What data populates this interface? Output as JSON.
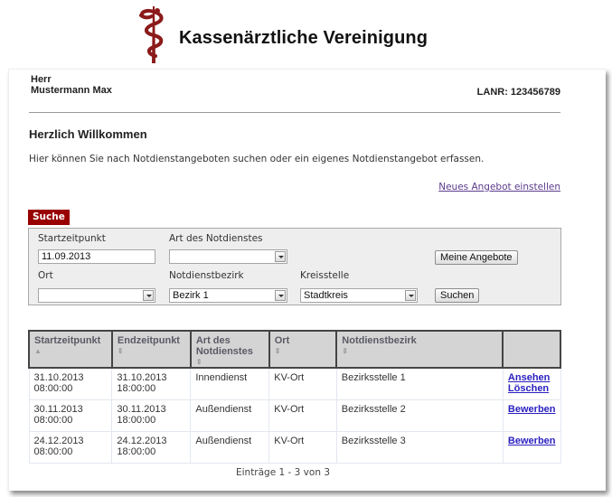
{
  "header": {
    "logo_icon": "rod-of-asclepius-icon",
    "brand_name": "Kassenärztliche Vereinigung",
    "brand_color": "#8b1a1a"
  },
  "user": {
    "salutation": "Herr",
    "name": "Mustermann Max",
    "lanr": "LANR: 123456789"
  },
  "intro": {
    "title": "Herzlich Willkommen",
    "text": "Hier können Sie nach Notdienstangeboten suchen oder ein eigenes Notdienstangebot erfassen.",
    "new_offer_link": "Neues Angebot einstellen"
  },
  "search": {
    "tab_label": "Suche",
    "accent_color": "#990000",
    "fields": {
      "start_label": "Startzeitpunkt",
      "start_value": "11.09.2013",
      "type_label": "Art des Notdienstes",
      "type_value": "",
      "place_label": "Ort",
      "place_value": "",
      "district_label": "Notdienstbezirk",
      "district_value": "Bezirk 1",
      "office_label": "Kreisstelle",
      "office_value": "Stadtkreis"
    },
    "my_offers_button": "Meine Angebote",
    "search_button": "Suchen"
  },
  "table": {
    "columns": [
      {
        "label": "Startzeitpunkt",
        "sort": "▲"
      },
      {
        "label": "Endzeitpunkt",
        "sort": "⇕"
      },
      {
        "label": "Art des Notdienstes",
        "sort": "⇕"
      },
      {
        "label": "Ort",
        "sort": "⇕"
      },
      {
        "label": "Notdienstbezirk",
        "sort": "⇕"
      },
      {
        "label": "",
        "sort": ""
      }
    ],
    "rows": [
      {
        "start_date": "31.10.2013",
        "start_time": "08:00:00",
        "end_date": "31.10.2013",
        "end_time": "18:00:00",
        "type": "Innendienst",
        "place": "KV-Ort",
        "district": "Bezirksstelle 1",
        "actions": [
          "Ansehen",
          "Löschen"
        ]
      },
      {
        "start_date": "30.11.2013",
        "start_time": "08:00:00",
        "end_date": "30.11.2013",
        "end_time": "18:00:00",
        "type": "Außendienst",
        "place": "KV-Ort",
        "district": "Bezirksstelle 2",
        "actions": [
          "Bewerben"
        ]
      },
      {
        "start_date": "24.12.2013",
        "start_time": "08:00:00",
        "end_date": "24.12.2013",
        "end_time": "18:00:00",
        "type": "Außendienst",
        "place": "KV-Ort",
        "district": "Bezirksstelle 3",
        "actions": [
          "Bewerben"
        ]
      }
    ],
    "pager_text": "Einträge 1 - 3 von 3"
  }
}
